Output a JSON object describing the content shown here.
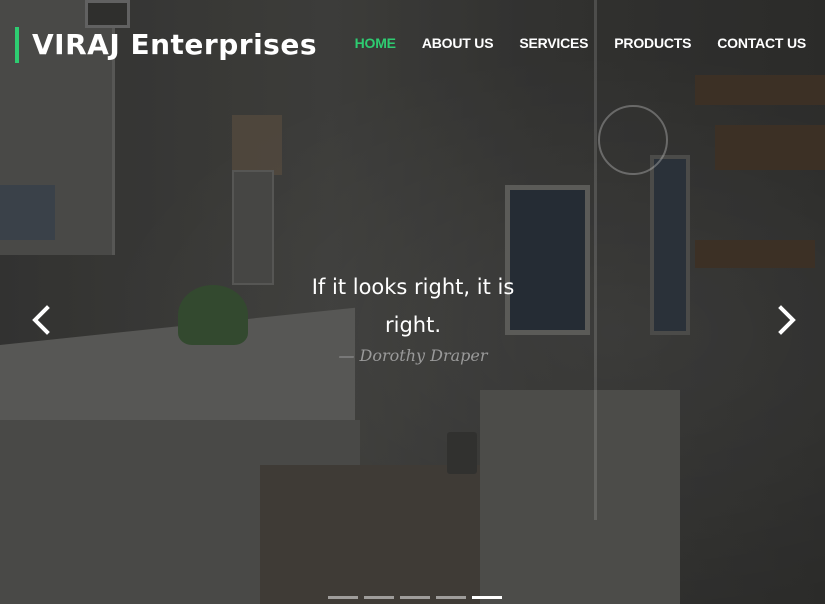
{
  "brand": {
    "name": "VIRAJ Enterprises",
    "accent_color": "#2ecc71"
  },
  "nav": {
    "items": [
      {
        "label": "HOME",
        "active": true
      },
      {
        "label": "ABOUT US",
        "active": false
      },
      {
        "label": "SERVICES",
        "active": false
      },
      {
        "label": "PRODUCTS",
        "active": false
      },
      {
        "label": "CONTACT US",
        "active": false
      }
    ]
  },
  "carousel": {
    "quote": "If it looks right, it is right.",
    "author": "— Dorothy Draper",
    "prev_icon": "chevron-left-icon",
    "next_icon": "chevron-right-icon",
    "slide_count": 5,
    "active_slide": 5
  }
}
